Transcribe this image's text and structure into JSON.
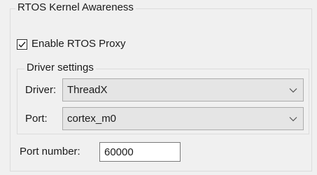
{
  "rtos": {
    "group_title": "RTOS Kernel Awareness",
    "enable_proxy": {
      "label": "Enable RTOS Proxy",
      "checked": true
    },
    "driver_settings": {
      "group_title": "Driver settings",
      "driver": {
        "label": "Driver:",
        "value": "ThreadX"
      },
      "port": {
        "label": "Port:",
        "value": "cortex_m0"
      }
    },
    "port_number": {
      "label": "Port number:",
      "value": "60000"
    }
  },
  "icons": {
    "check": "check-icon",
    "dropdown": "chevron-down-icon"
  },
  "colors": {
    "background": "#f0f0f0",
    "combo_background": "#e5e5e5",
    "input_background": "#ffffff"
  }
}
